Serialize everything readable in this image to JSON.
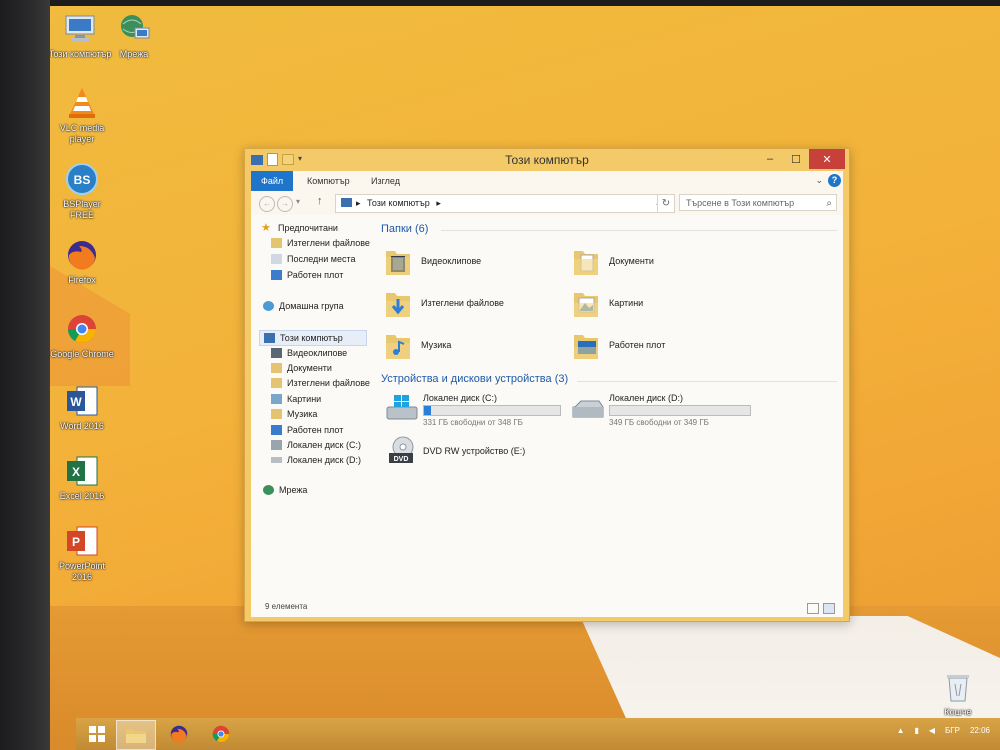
{
  "desktop": {
    "icons": [
      {
        "label": "Този компютър",
        "icon": "computer-icon"
      },
      {
        "label": "Мрежа",
        "icon": "network-icon"
      },
      {
        "label": "VLC media player",
        "icon": "vlc-icon"
      },
      {
        "label": "BSPlayer FREE",
        "icon": "bsplayer-icon"
      },
      {
        "label": "Firefox",
        "icon": "firefox-icon"
      },
      {
        "label": "Google Chrome",
        "icon": "chrome-icon"
      },
      {
        "label": "Word 2016",
        "icon": "word-icon"
      },
      {
        "label": "Excel 2016",
        "icon": "excel-icon"
      },
      {
        "label": "PowerPoint 2016",
        "icon": "powerpoint-icon"
      },
      {
        "label": "Кошче",
        "icon": "recycle-bin-icon"
      }
    ]
  },
  "window": {
    "title": "Този компютър",
    "buttons": {
      "minimize": "–",
      "maximize": "☐",
      "close": "✕"
    },
    "ribbon": {
      "tabs": [
        "Файл",
        "Компютър",
        "Изглед"
      ],
      "help": "?"
    },
    "address": {
      "back": "←",
      "forward": "→",
      "up": "↑",
      "path": "Този компютър",
      "separator": "▸",
      "search_placeholder": "Търсене в Този компютър"
    },
    "nav": {
      "favorites": "Предпочитани",
      "favorites_items": [
        "Изтеглени файлове",
        "Последни места",
        "Работен плот"
      ],
      "homegroup": "Домашна група",
      "computer": "Този компютър",
      "computer_items": [
        "Видеоклипове",
        "Документи",
        "Изтеглени файлове",
        "Картини",
        "Музика",
        "Работен плот",
        "Локален диск (C:)",
        "Локален диск (D:)"
      ],
      "network": "Мрежа"
    },
    "folders_header": "Папки (6)",
    "folders": [
      "Видеоклипове",
      "Документи",
      "Изтеглени файлове",
      "Картини",
      "Музика",
      "Работен плот"
    ],
    "devices_header": "Устройства и дискови устройства (3)",
    "drives": [
      {
        "name": "Локален диск (C:)",
        "free": "331 ГБ свободни от 348 ГБ",
        "used_fraction": 0.05
      },
      {
        "name": "Локален диск (D:)",
        "free": "349 ГБ свободни от 349 ГБ",
        "used_fraction": 0.0
      },
      {
        "name": "DVD RW устройство (E:)"
      }
    ],
    "status": "9 елемента"
  },
  "taskbar": {
    "tray": {
      "language": "БГР",
      "time": "22:06"
    }
  },
  "colors": {
    "desktop": "#f2b23a",
    "window_frame": "#f4c967",
    "close_button": "#c7403a",
    "accent_blue": "#1e75c9"
  }
}
